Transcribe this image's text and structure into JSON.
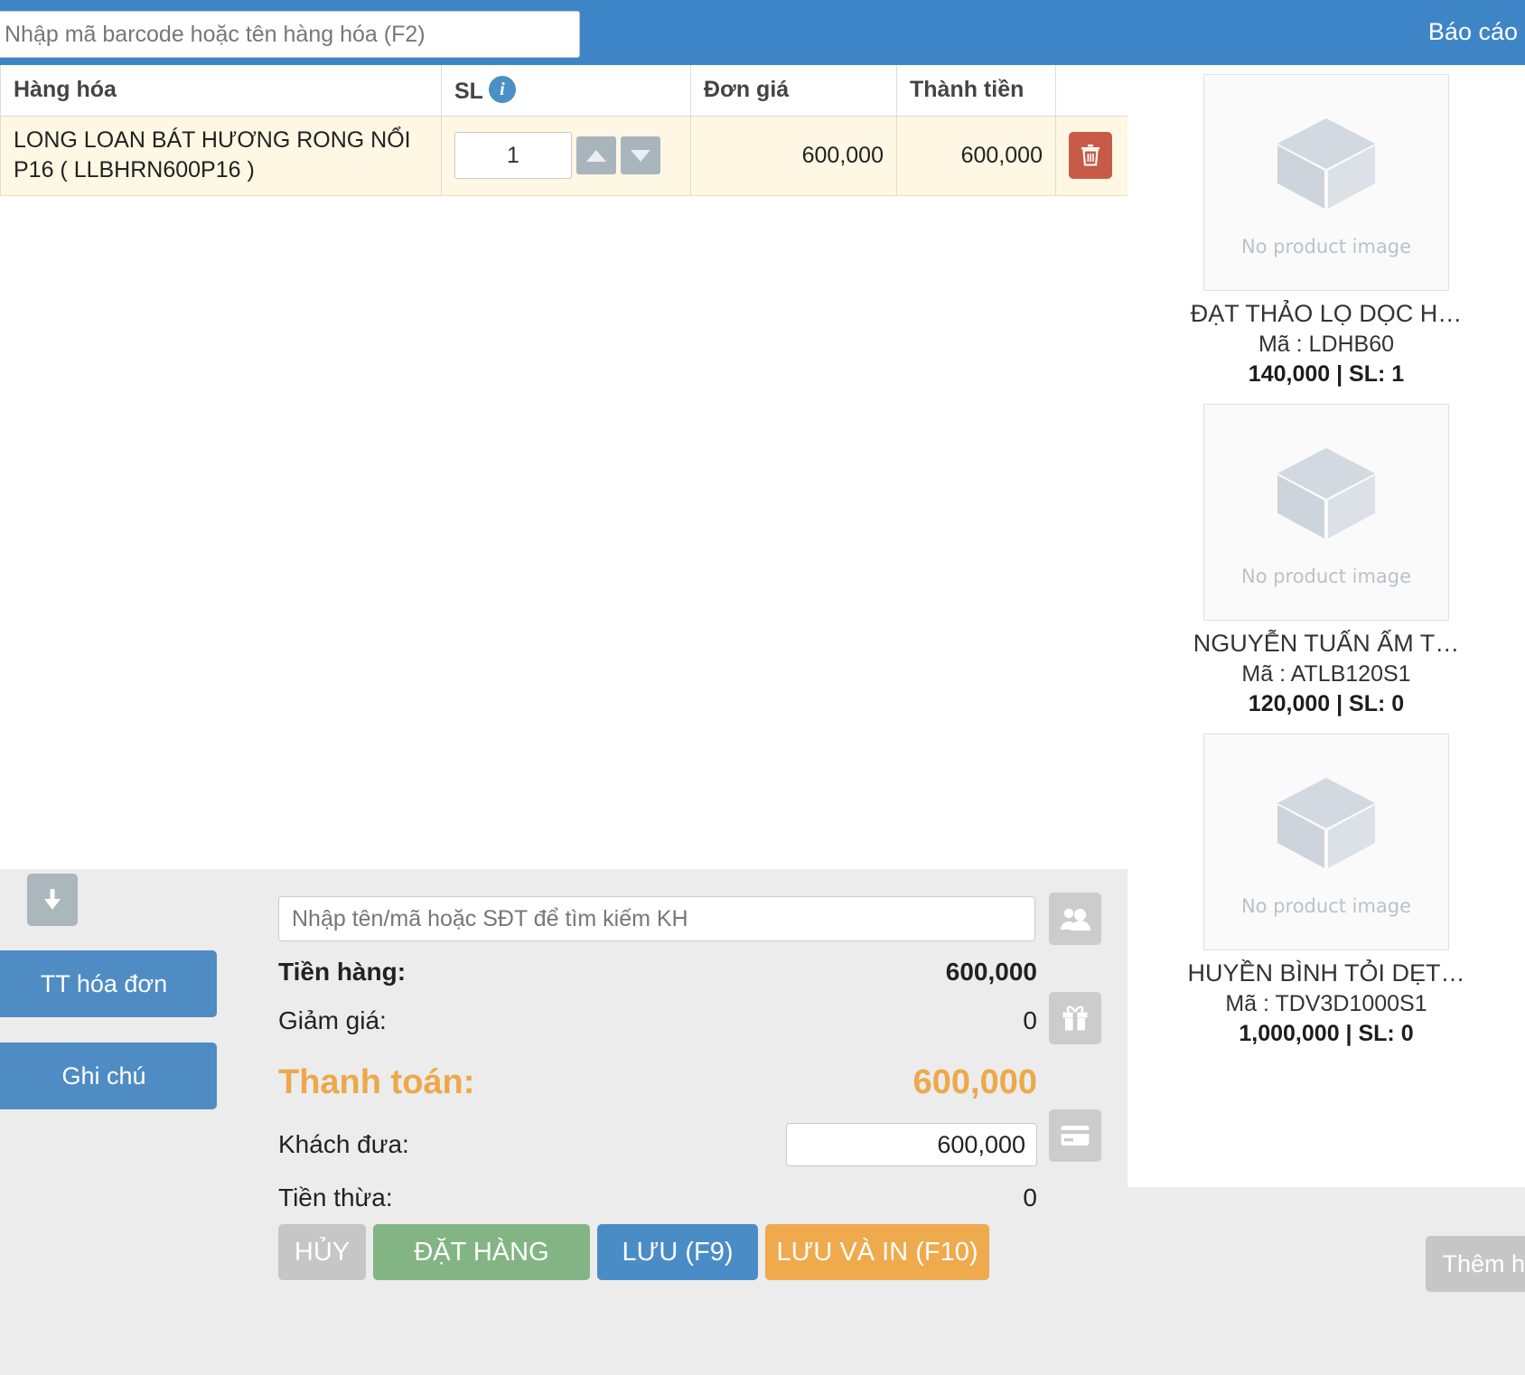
{
  "topbar": {
    "search_placeholder": "Nhập mã barcode hoặc tên hàng hóa (F2)",
    "search_value": "",
    "menu_right": "Báo cáo"
  },
  "cart": {
    "columns": {
      "name": "Hàng hóa",
      "qty": "SL",
      "price": "Đơn giá",
      "total": "Thành tiền",
      "action": ""
    },
    "rows": [
      {
        "name": "LONG LOAN BÁT HƯƠNG RONG NỔI P16 ( LLBHRN600P16 )",
        "qty": "1",
        "price": "600,000",
        "total": "600,000"
      }
    ]
  },
  "products": {
    "no_image_text": "No product image",
    "items": [
      {
        "title": "ĐẠT THẢO LỌ DỌC H…",
        "code": "Mã : LDHB60",
        "price_stock": "140,000 | SL: 1"
      },
      {
        "title": "NGUYỄN TUẤN ẤM T…",
        "code": "Mã : ATLB120S1",
        "price_stock": "120,000 | SL: 0"
      },
      {
        "title": "HUYỀN BÌNH TỎI DẸT…",
        "code": "Mã : TDV3D1000S1",
        "price_stock": "1,000,000 | SL: 0"
      }
    ],
    "add_more_label": "Thêm h"
  },
  "payment": {
    "customer_placeholder": "Nhập tên/mã hoặc SĐT để tìm kiếm KH",
    "customer_value": "",
    "subtotal_label": "Tiền hàng:",
    "subtotal_value": "600,000",
    "discount_label": "Giảm giá:",
    "discount_value": "0",
    "total_label": "Thanh toán:",
    "total_value": "600,000",
    "cash_label": "Khách đưa:",
    "cash_value": "600,000",
    "change_label": "Tiền thừa:",
    "change_value": "0"
  },
  "side_buttons": {
    "invoice_payment": "TT hóa đơn",
    "note": "Ghi chú"
  },
  "actions": {
    "cancel": "HỦY",
    "order": "ĐẶT HÀNG",
    "save": "LƯU (F9)",
    "save_print": "LƯU VÀ IN (F10)"
  },
  "colors": {
    "header_blue": "#3d85c6",
    "accent_orange": "#eda84a",
    "danger_red": "#c75b47",
    "success_green": "#83b584"
  }
}
